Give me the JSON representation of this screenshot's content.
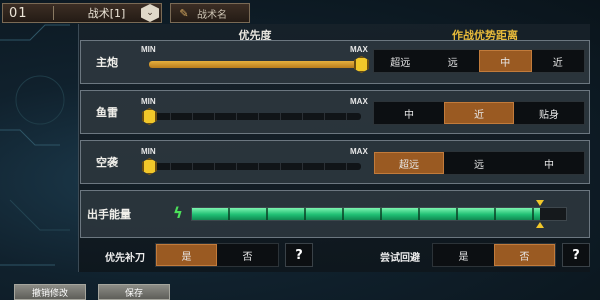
{
  "top_bar": {
    "tactic_number": "01",
    "tactic_name": "战术[1]",
    "toggle_glyph": "⌄",
    "rename_label": "战术名"
  },
  "headers": {
    "priority": "优先度",
    "combat_distance": "作战优势距离"
  },
  "rows": [
    {
      "label": "主炮",
      "min": "MIN",
      "max": "MAX",
      "priority_level": 1.0,
      "distance_options": [
        "超远",
        "远",
        "中",
        "近"
      ],
      "distance_selected": "中"
    },
    {
      "label": "鱼雷",
      "min": "MIN",
      "max": "MAX",
      "priority_level": 0.0,
      "distance_options": [
        "中",
        "近",
        "贴身"
      ],
      "distance_selected": "近"
    },
    {
      "label": "空袭",
      "min": "MIN",
      "max": "MAX",
      "priority_level": 0.0,
      "distance_options": [
        "超远",
        "远",
        "中"
      ],
      "distance_selected": "超远"
    }
  ],
  "output": {
    "label": "出手能量",
    "level": 0.93
  },
  "toggles": [
    {
      "label": "优先补刀",
      "options": [
        "是",
        "否"
      ],
      "selected": "是",
      "help": "?"
    },
    {
      "label": "尝试回避",
      "options": [
        "是",
        "否"
      ],
      "selected": "否",
      "help": "?"
    }
  ],
  "bottom": {
    "revert_label": "撤销修改",
    "save_label": "保存"
  },
  "colors": {
    "accent_orange": "#9a5a22",
    "slider_gold": "#e6b03e",
    "header_gold": "#e6b93a",
    "energy_green": "#1fbf73"
  }
}
